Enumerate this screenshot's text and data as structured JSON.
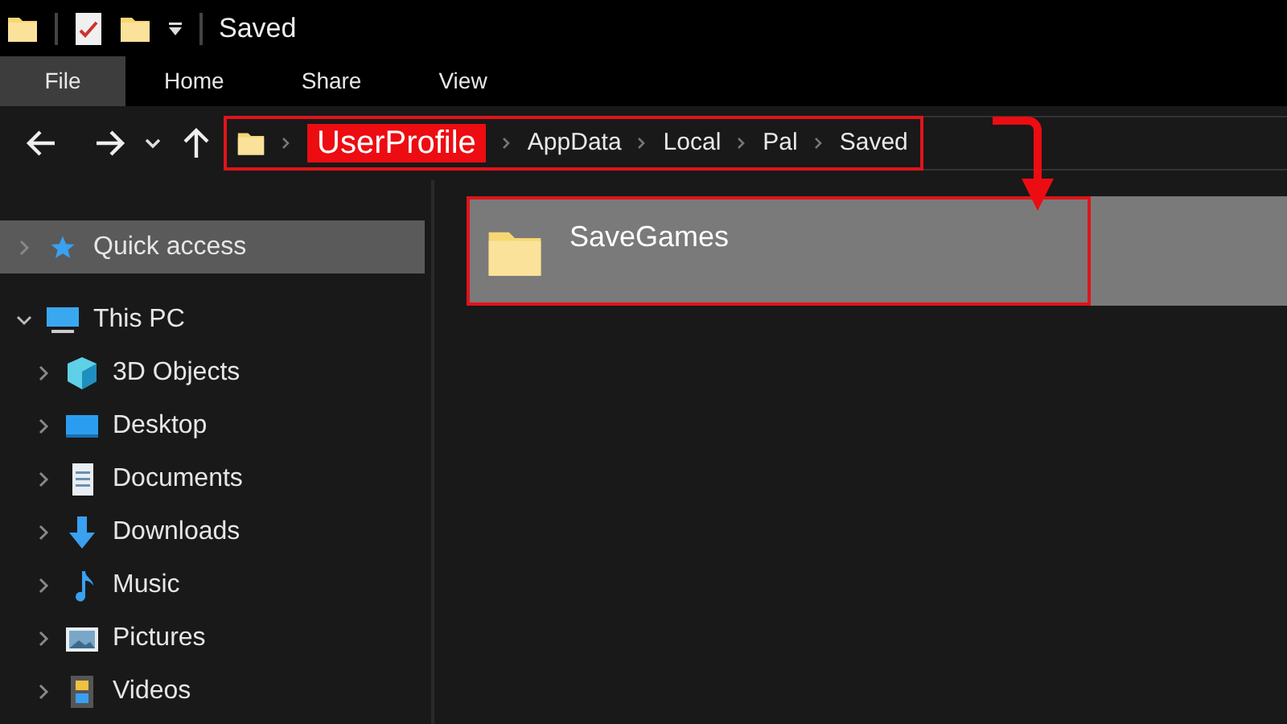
{
  "window": {
    "title": "Saved"
  },
  "ribbon_tabs": [
    {
      "label": "File",
      "selected": true
    },
    {
      "label": "Home",
      "selected": false
    },
    {
      "label": "Share",
      "selected": false
    },
    {
      "label": "View",
      "selected": false
    }
  ],
  "address_bar": {
    "outlined": true,
    "crumbs": [
      {
        "label": "UserProfile",
        "highlighted": true
      },
      {
        "label": "AppData",
        "highlighted": false
      },
      {
        "label": "Local",
        "highlighted": false
      },
      {
        "label": "Pal",
        "highlighted": false
      },
      {
        "label": "Saved",
        "highlighted": false
      }
    ]
  },
  "sidebar": {
    "items": [
      {
        "label": "Quick access",
        "kind": "star",
        "selected": true,
        "expanded": false
      },
      {
        "label": "This PC",
        "kind": "pc",
        "selected": false,
        "expanded": true,
        "children": [
          {
            "label": "3D Objects",
            "kind": "cube",
            "selected": false,
            "expanded": false
          },
          {
            "label": "Desktop",
            "kind": "desktop",
            "selected": false,
            "expanded": false
          },
          {
            "label": "Documents",
            "kind": "document",
            "selected": false,
            "expanded": false
          },
          {
            "label": "Downloads",
            "kind": "download",
            "selected": false,
            "expanded": false
          },
          {
            "label": "Music",
            "kind": "music",
            "selected": false,
            "expanded": false
          },
          {
            "label": "Pictures",
            "kind": "picture",
            "selected": false,
            "expanded": false
          },
          {
            "label": "Videos",
            "kind": "video",
            "selected": false,
            "expanded": false
          }
        ]
      }
    ]
  },
  "files": [
    {
      "name": "SaveGames",
      "selected": true,
      "outlined": true
    }
  ]
}
